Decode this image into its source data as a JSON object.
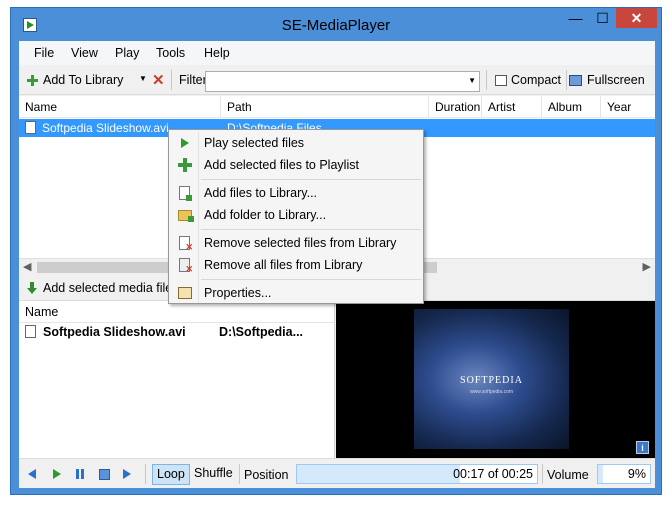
{
  "window": {
    "title": "SE-MediaPlayer",
    "minimize_glyph": "—",
    "maximize_glyph": "☐",
    "close_glyph": "✕"
  },
  "menu": [
    "File",
    "View",
    "Play",
    "Tools",
    "Help"
  ],
  "toolbar": {
    "add_to_library": "Add To Library",
    "filter_label": "Filter",
    "filter_value": "",
    "compact": "Compact",
    "fullscreen": "Fullscreen"
  },
  "library": {
    "columns": [
      "Name",
      "Path",
      "Duration",
      "Artist",
      "Album",
      "Year"
    ],
    "rows": [
      {
        "name": "Softpedia Slideshow.avi",
        "path": "D:\\Softpedia Files"
      }
    ]
  },
  "add_selected_label": "Add selected media files",
  "playlist": {
    "columns": [
      "Name"
    ],
    "rows": [
      {
        "name": "Softpedia Slideshow.avi",
        "path": "D:\\Softpedia..."
      }
    ]
  },
  "video": {
    "logo": "SOFTPEDIA",
    "url": "www.softpedia.com"
  },
  "controls": {
    "loop": "Loop",
    "shuffle": "Shuffle",
    "position_label": "Position",
    "position_text": "00:17 of 00:25",
    "position_fraction": 0.68,
    "volume_label": "Volume",
    "volume_text": "9%",
    "volume_fraction": 0.09
  },
  "context_menu": {
    "items": [
      {
        "label": "Play selected files",
        "icon": "play-icon"
      },
      {
        "label": "Add selected files to Playlist",
        "icon": "add-playlist-icon"
      },
      {
        "label": "Add files to Library...",
        "icon": "add-file-icon"
      },
      {
        "label": "Add folder to Library...",
        "icon": "add-folder-icon"
      },
      {
        "label": "Remove selected files from Library",
        "icon": "remove-file-icon"
      },
      {
        "label": "Remove all files from Library",
        "icon": "remove-all-icon"
      },
      {
        "label": "Properties...",
        "icon": "properties-icon"
      }
    ]
  },
  "colors": {
    "window_frame": "#4a8fd8",
    "selection": "#3399ff",
    "close_button": "#c7463e"
  }
}
